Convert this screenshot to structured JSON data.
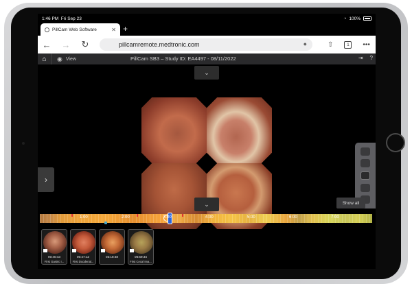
{
  "status_bar": {
    "time": "1:46 PM",
    "date": "Fri Sep 23",
    "battery": "100%"
  },
  "browser": {
    "tab_title": "PillCam Web Software",
    "tab_close": "✕",
    "new_tab": "+",
    "url": "pillcamremote.medtronic.com",
    "tab_count": "1",
    "more": "•••"
  },
  "app_bar": {
    "view_label": "View",
    "study_title": "PillCam SB3 – Study ID: EA4497 - 08/11/2022",
    "help": "?"
  },
  "viewer": {
    "show_all_label": "Show all"
  },
  "timeline": {
    "ticks": [
      "1:00",
      "2:00",
      "3:00",
      "4:00",
      "5:00",
      "6:00",
      "7:00"
    ],
    "progress": 0.385
  },
  "landmarks": [
    {
      "time": "00:40:43",
      "label": "First Gastric I..."
    },
    {
      "time": "00:47:12",
      "label": "First Duodenal..."
    },
    {
      "time": "03:18:48",
      "label": ""
    },
    {
      "time": "06:59:34",
      "label": "First Cecal Ima..."
    }
  ],
  "colors": {
    "playhead": "#2b63d8",
    "app_bar": "#2a2a2c"
  }
}
